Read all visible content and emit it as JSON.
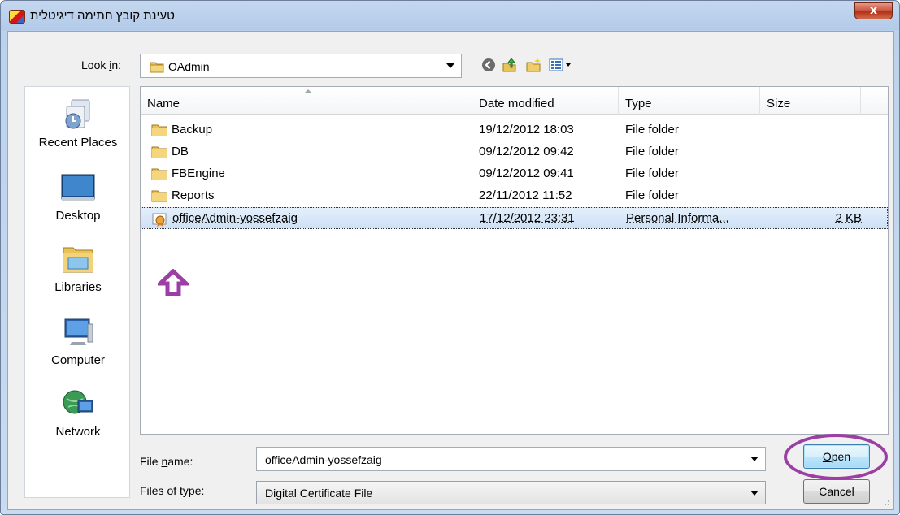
{
  "window": {
    "title": "טעינת קובץ חתימה דיגיטלית",
    "close_label": "x"
  },
  "toolbar": {
    "look_in_label": "Look in:",
    "look_in_underline": "i",
    "look_in_value": "OAdmin",
    "back_icon": "back-arrow-icon",
    "up_icon": "up-folder-icon",
    "new_folder_icon": "new-folder-icon",
    "views_icon": "views-menu-icon"
  },
  "places": [
    {
      "label": "Recent Places",
      "icon": "recent-places-icon"
    },
    {
      "label": "Desktop",
      "icon": "desktop-icon"
    },
    {
      "label": "Libraries",
      "icon": "libraries-icon"
    },
    {
      "label": "Computer",
      "icon": "computer-icon"
    },
    {
      "label": "Network",
      "icon": "network-icon"
    }
  ],
  "columns": {
    "name": "Name",
    "date": "Date modified",
    "type": "Type",
    "size": "Size"
  },
  "files": [
    {
      "name": "Backup",
      "date": "19/12/2012 18:03",
      "type": "File folder",
      "size": "",
      "kind": "folder"
    },
    {
      "name": "DB",
      "date": "09/12/2012 09:42",
      "type": "File folder",
      "size": "",
      "kind": "folder"
    },
    {
      "name": "FBEngine",
      "date": "09/12/2012 09:41",
      "type": "File folder",
      "size": "",
      "kind": "folder"
    },
    {
      "name": "Reports",
      "date": "22/11/2012 11:52",
      "type": "File folder",
      "size": "",
      "kind": "folder"
    },
    {
      "name": "officeAdmin-yossefzaig",
      "date": "17/12/2012 23:31",
      "type": "Personal Informa...",
      "size": "2 KB",
      "kind": "certificate",
      "selected": true
    }
  ],
  "bottom": {
    "file_name_label_pre": "File ",
    "file_name_label_u": "n",
    "file_name_label_post": "ame:",
    "file_name_value": "officeAdmin-yossefzaig",
    "file_type_label": "Files of type:",
    "file_type_value": "Digital Certificate File",
    "open_label_u": "O",
    "open_label_post": "pen",
    "cancel_label": "Cancel"
  },
  "colors": {
    "annotation": "#9b3fa4",
    "selection": "#cde1f6",
    "title_bar": "#b3cbe9"
  }
}
